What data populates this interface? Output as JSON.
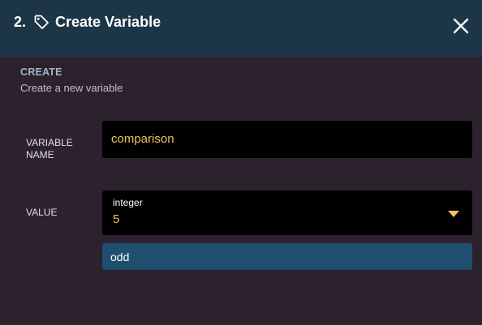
{
  "header": {
    "step": "2.",
    "title": "Create Variable",
    "icon": "tag-icon",
    "close_icon": "close-icon",
    "background": "#1c3648"
  },
  "section": {
    "title": "CREATE",
    "subtitle": "Create a new variable"
  },
  "form": {
    "name_label": "VARIABLE NAME",
    "name_value": "comparison",
    "value_label": "VALUE",
    "value_type": "integer",
    "value_number": "5",
    "option_label": "odd"
  },
  "colors": {
    "accent_value": "#f0c35b",
    "option_highlight": "#1f4e6e",
    "panel_background": "#2b222e"
  }
}
